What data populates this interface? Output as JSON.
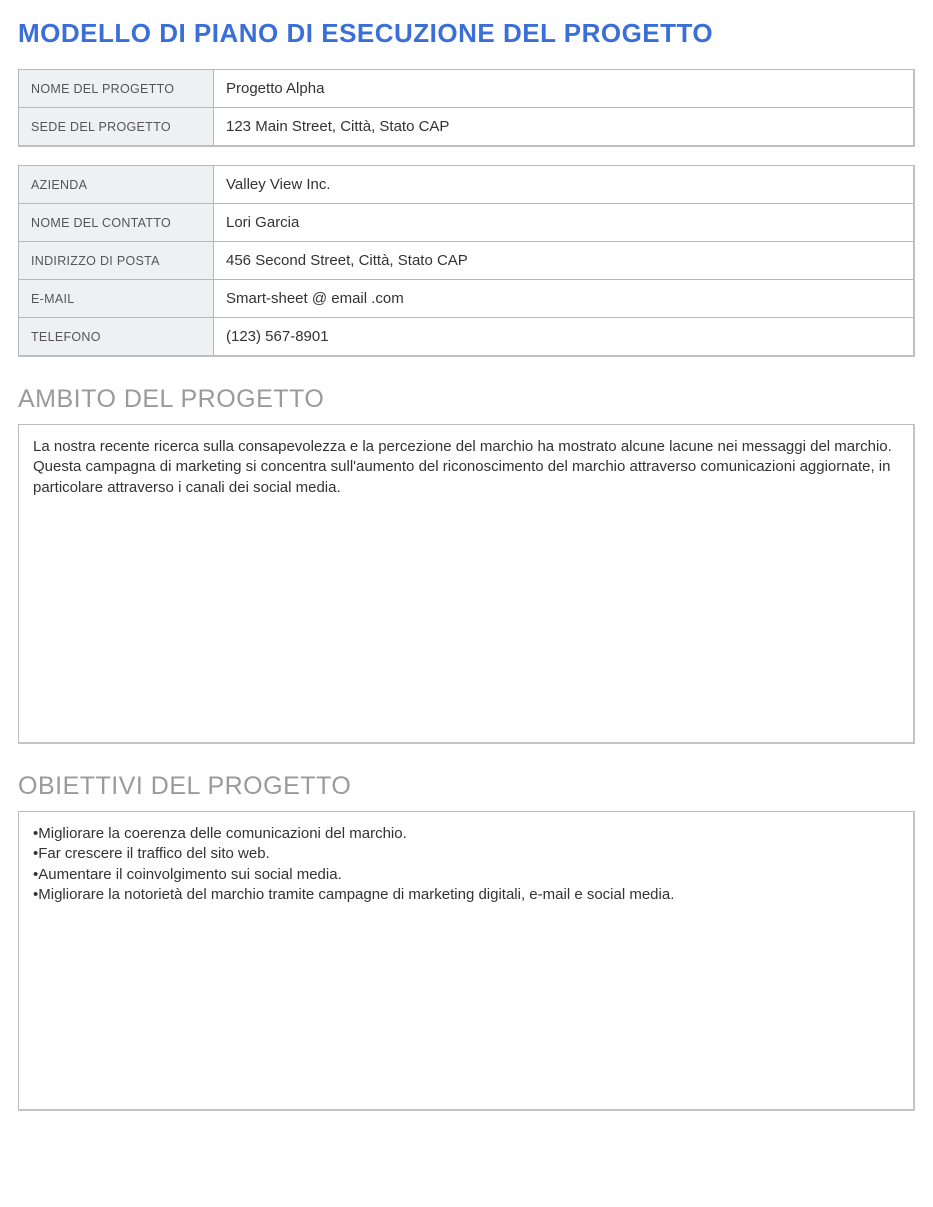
{
  "title": "MODELLO DI PIANO DI ESECUZIONE DEL PROGETTO",
  "project_table": {
    "rows": [
      {
        "label": "NOME DEL PROGETTO",
        "value": "Progetto Alpha"
      },
      {
        "label": "SEDE DEL PROGETTO",
        "value": "123 Main Street, Città, Stato CAP"
      }
    ]
  },
  "contact_table": {
    "rows": [
      {
        "label": "AZIENDA",
        "value": "Valley View Inc."
      },
      {
        "label": "NOME DEL CONTATTO",
        "value": "Lori Garcia"
      },
      {
        "label": "INDIRIZZO DI POSTA",
        "value": "456 Second Street, Città, Stato CAP"
      },
      {
        "label": "E-MAIL",
        "value": "Smart-sheet @ email .com"
      },
      {
        "label": "TELEFONO",
        "value": "(123) 567-8901"
      }
    ]
  },
  "scope": {
    "heading": "AMBITO DEL PROGETTO",
    "text": "La nostra recente ricerca sulla consapevolezza e la percezione del marchio ha mostrato alcune lacune nei messaggi del marchio. Questa campagna di marketing si concentra sull'aumento del riconoscimento del marchio attraverso comunicazioni aggiornate, in particolare attraverso i canali dei social media."
  },
  "objectives": {
    "heading": "OBIETTIVI DEL PROGETTO",
    "items": [
      "•Migliorare la coerenza delle comunicazioni del marchio.",
      "•Far crescere il traffico del sito web.",
      "•Aumentare il coinvolgimento sui social media.",
      "•Migliorare la notorietà del marchio tramite campagne di marketing digitali, e-mail e social media."
    ]
  }
}
